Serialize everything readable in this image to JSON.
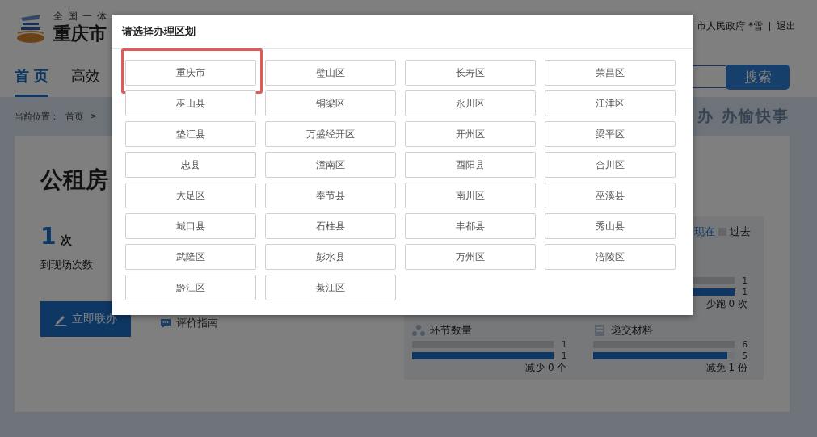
{
  "header": {
    "platform": "全国一体",
    "title": "重庆市",
    "user": "市人民政府 *雪",
    "logout": "退出"
  },
  "nav": {
    "tabs": [
      {
        "label": "首 页",
        "selected": true
      },
      {
        "label": "高效",
        "selected": false
      }
    ],
    "search_button": "搜索"
  },
  "breadcrumb": {
    "label": "当前位置：",
    "home": "首页",
    "separator": ">"
  },
  "slogan": "办 办愉快事",
  "service": {
    "title": "公租房",
    "visits": {
      "value": "1",
      "unit": "次",
      "label": "到现场次数"
    },
    "apply_button": "立即联办",
    "guide_link": "评价指南",
    "legend": {
      "now": "现在",
      "past": "过去"
    },
    "stats": [
      {
        "past": {
          "value": "1",
          "level": 1
        },
        "now": {
          "value": "1",
          "level": 1
        },
        "summary": "少跑 0 次"
      },
      {
        "kind": "steps",
        "title": "环节数量",
        "past": {
          "value": "1",
          "level": 1
        },
        "now": {
          "value": "1",
          "level": 1
        },
        "summary": "减少 0 个"
      },
      {
        "kind": "materials",
        "title": "递交材料",
        "past": {
          "value": "6",
          "level": 1
        },
        "now": {
          "value": "5",
          "level": 0.95
        },
        "summary": "减免 1 份"
      }
    ]
  },
  "modal": {
    "title": "请选择办理区划",
    "regions": [
      {
        "label": "重庆市",
        "highlighted": true
      },
      {
        "label": "璧山区",
        "highlighted": false
      },
      {
        "label": "长寿区",
        "highlighted": false
      },
      {
        "label": "荣昌区",
        "highlighted": false
      },
      {
        "label": "巫山县",
        "highlighted": false
      },
      {
        "label": "铜梁区",
        "highlighted": false
      },
      {
        "label": "永川区",
        "highlighted": false
      },
      {
        "label": "江津区",
        "highlighted": false
      },
      {
        "label": "垫江县",
        "highlighted": false
      },
      {
        "label": "万盛经开区",
        "highlighted": false
      },
      {
        "label": "开州区",
        "highlighted": false
      },
      {
        "label": "梁平区",
        "highlighted": false
      },
      {
        "label": "忠县",
        "highlighted": false
      },
      {
        "label": "潼南区",
        "highlighted": false
      },
      {
        "label": "酉阳县",
        "highlighted": false
      },
      {
        "label": "合川区",
        "highlighted": false
      },
      {
        "label": "大足区",
        "highlighted": false
      },
      {
        "label": "奉节县",
        "highlighted": false
      },
      {
        "label": "南川区",
        "highlighted": false
      },
      {
        "label": "巫溪县",
        "highlighted": false
      },
      {
        "label": "城口县",
        "highlighted": false
      },
      {
        "label": "石柱县",
        "highlighted": false
      },
      {
        "label": "丰都县",
        "highlighted": false
      },
      {
        "label": "秀山县",
        "highlighted": false
      },
      {
        "label": "武隆区",
        "highlighted": false
      },
      {
        "label": "彭水县",
        "highlighted": false
      },
      {
        "label": "万州区",
        "highlighted": false
      },
      {
        "label": "涪陵区",
        "highlighted": false
      },
      {
        "label": "黔江区",
        "highlighted": false
      },
      {
        "label": "綦江区",
        "highlighted": false
      }
    ]
  }
}
